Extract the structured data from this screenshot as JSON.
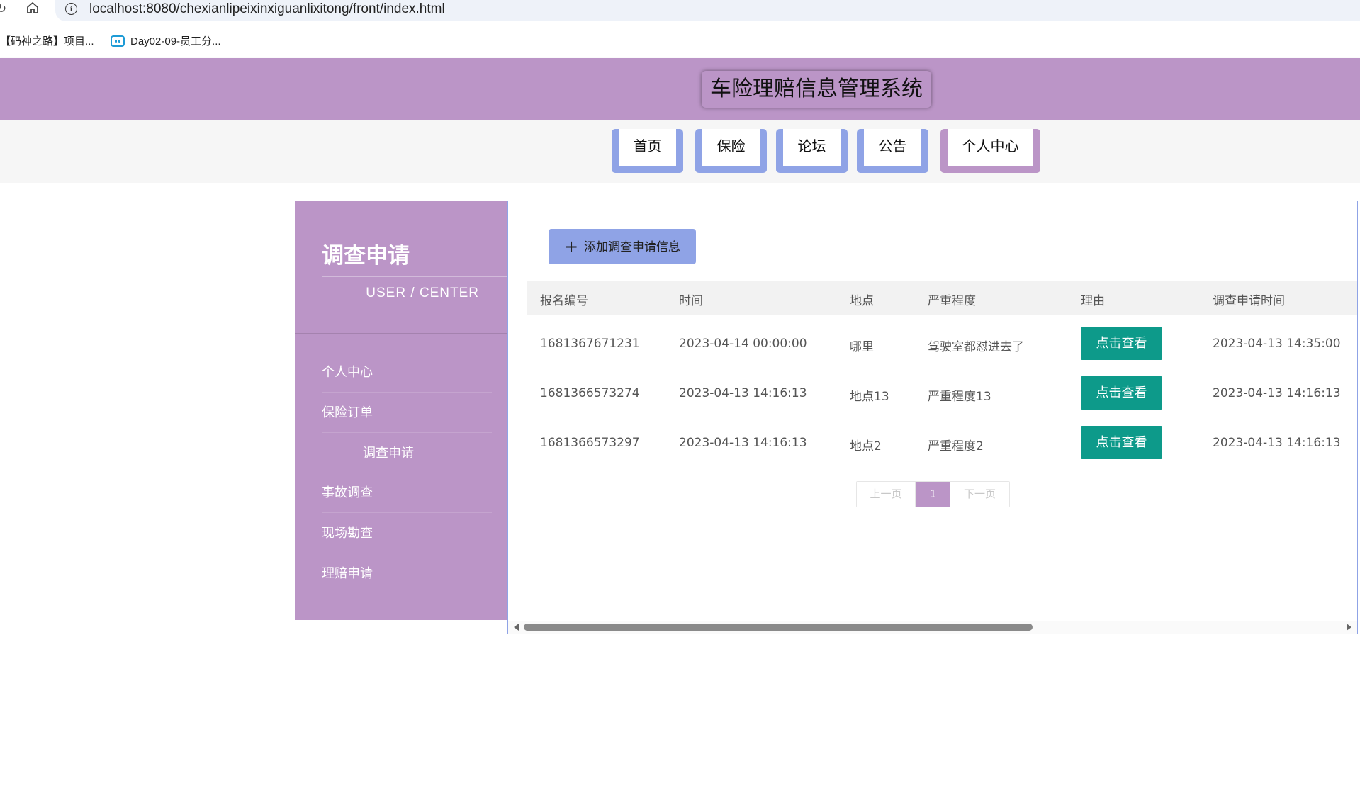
{
  "browser": {
    "url": "localhost:8080/chexianlipeixinxiguanlixitong/front/index.html",
    "bookmarks": [
      "【码神之路】项目...",
      "Day02-09-员工分..."
    ]
  },
  "header": {
    "title": "车险理赔信息管理系统"
  },
  "nav": {
    "items": [
      "首页",
      "保险",
      "论坛",
      "公告",
      "个人中心"
    ],
    "active": "个人中心"
  },
  "sidebar": {
    "title": "调查申请",
    "subtitle": "USER / CENTER",
    "items": [
      "个人中心",
      "保险订单",
      "调查申请",
      "事故调查",
      "现场勘查",
      "理赔申请"
    ]
  },
  "main": {
    "add_button": "添加调查申请信息",
    "columns": [
      "报名编号",
      "时间",
      "地点",
      "严重程度",
      "理由",
      "调查申请时间"
    ],
    "rows": [
      {
        "id": "1681367671231",
        "time": "2023-04-14 00:00:00",
        "place": "哪里",
        "severity": "驾驶室都怼进去了",
        "reason_btn": "点击查看",
        "apply_time": "2023-04-13 14:35:00"
      },
      {
        "id": "1681366573274",
        "time": "2023-04-13 14:16:13",
        "place": "地点13",
        "severity": "严重程度13",
        "reason_btn": "点击查看",
        "apply_time": "2023-04-13 14:16:13"
      },
      {
        "id": "1681366573297",
        "time": "2023-04-13 14:16:13",
        "place": "地点2",
        "severity": "严重程度2",
        "reason_btn": "点击查看",
        "apply_time": "2023-04-13 14:16:13"
      }
    ],
    "pager": {
      "prev": "上一页",
      "current": "1",
      "next": "下一页"
    }
  },
  "colors": {
    "header": "#bb95c7",
    "nav_border": "#8fa3e6",
    "view_button": "#0d9a8a"
  }
}
